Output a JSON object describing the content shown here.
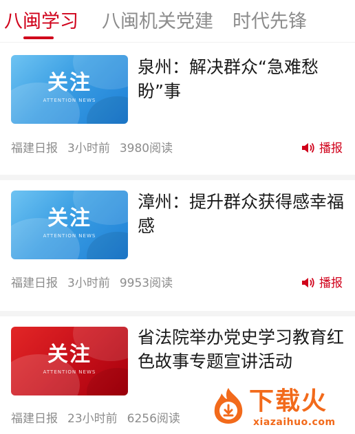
{
  "tabs": [
    {
      "label": "八闽学习",
      "active": true
    },
    {
      "label": "八闽机关党建",
      "active": false
    },
    {
      "label": "时代先锋",
      "active": false
    }
  ],
  "accent_color": "#d0021b",
  "articles": [
    {
      "thumb_title": "关注",
      "thumb_sub": "ATTENTION NEWS",
      "thumb_color": "blue",
      "headline": "泉州：解决群众“急难愁盼”事",
      "source": "福建日报",
      "time": "3小时前",
      "reads": "3980阅读",
      "broadcast_label": "播报"
    },
    {
      "thumb_title": "关注",
      "thumb_sub": "ATTENTION NEWS",
      "thumb_color": "blue",
      "headline": "漳州：提升群众获得感幸福感",
      "source": "福建日报",
      "time": "3小时前",
      "reads": "9953阅读",
      "broadcast_label": "播报"
    },
    {
      "thumb_title": "关注",
      "thumb_sub": "ATTENTION NEWS",
      "thumb_color": "red",
      "headline": "省法院举办党史学习教育红色故事专题宣讲活动",
      "source": "福建日报",
      "time": "23小时前",
      "reads": "6256阅读"
    }
  ],
  "watermark": {
    "brand": "下载火",
    "url": "xiazaihuo.com",
    "icon": "flame-download-icon"
  }
}
